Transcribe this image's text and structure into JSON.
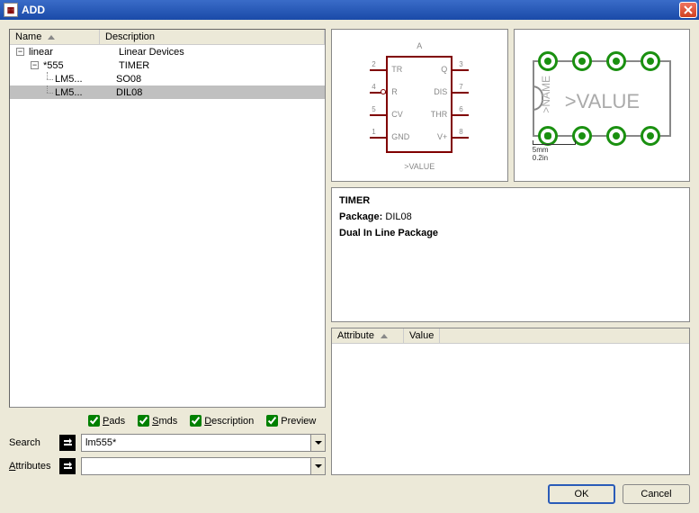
{
  "title": "ADD",
  "tree": {
    "headers": {
      "name": "Name",
      "desc": "Description"
    },
    "rows": [
      {
        "indent": 0,
        "expanded": true,
        "name": "linear",
        "desc": "Linear Devices"
      },
      {
        "indent": 1,
        "expanded": true,
        "name": "*555",
        "desc": "TIMER"
      },
      {
        "indent": 2,
        "leaf": true,
        "name": "LM5...",
        "desc": "SO08"
      },
      {
        "indent": 2,
        "leaf": true,
        "selected": true,
        "name": "LM5...",
        "desc": "DIL08"
      }
    ]
  },
  "checks": {
    "pads": {
      "letter": "P",
      "rest": "ads",
      "checked": true
    },
    "smds": {
      "letter": "S",
      "rest": "mds",
      "checked": true
    },
    "desc": {
      "letter": "D",
      "rest": "escription",
      "checked": true
    },
    "prev": {
      "letter": "",
      "rest": "Preview",
      "checked": true
    }
  },
  "search": {
    "label": "Search",
    "value": "lm555*"
  },
  "attributes": {
    "label": "Attributes",
    "value": ""
  },
  "symbol": {
    "topLabel": "A",
    "bottomLabel": ">VALUE",
    "pins": {
      "left": [
        {
          "num": "2",
          "label": "TR"
        },
        {
          "num": "4",
          "label": "R",
          "bubble": true
        },
        {
          "num": "5",
          "label": "CV"
        },
        {
          "num": "1",
          "label": "GND"
        }
      ],
      "right": [
        {
          "num": "3",
          "label": "Q"
        },
        {
          "num": "7",
          "label": "DIS"
        },
        {
          "num": "6",
          "label": "THR"
        },
        {
          "num": "8",
          "label": "V+"
        }
      ]
    }
  },
  "package": {
    "nameLabel": ">NAME",
    "valueLabel": ">VALUE",
    "scale": {
      "mm": "5mm",
      "in": "0.2in"
    }
  },
  "description": {
    "title": "TIMER",
    "packageLabel": "Package:",
    "packageValue": "DIL08",
    "note": "Dual In Line Package"
  },
  "attrTable": {
    "headers": {
      "attr": "Attribute",
      "value": "Value"
    }
  },
  "buttons": {
    "ok": "OK",
    "cancel": "Cancel"
  }
}
